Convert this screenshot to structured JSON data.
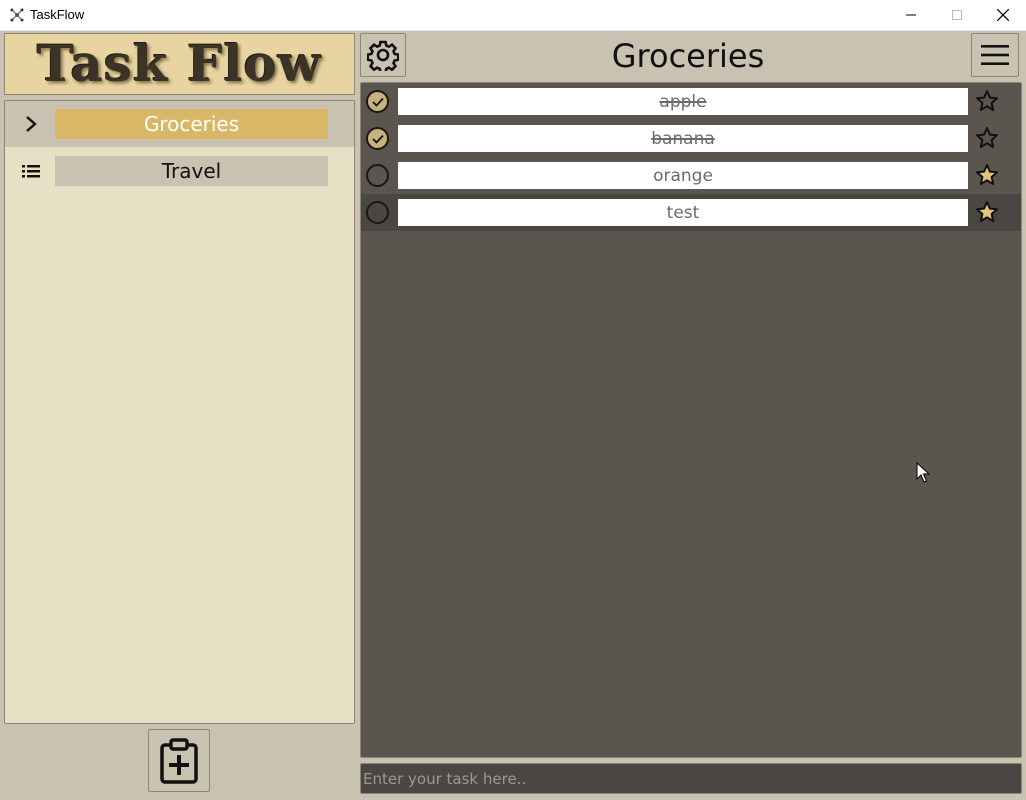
{
  "window": {
    "title": "TaskFlow",
    "controls": [
      "minimize",
      "maximize",
      "close"
    ]
  },
  "logo": {
    "text": "Task Flow"
  },
  "lists": [
    {
      "label": "Groceries",
      "icon": "chevron-right-icon",
      "selected": true
    },
    {
      "label": "Travel",
      "icon": "list-icon",
      "selected": false
    }
  ],
  "header": {
    "title": "Groceries"
  },
  "tasks": [
    {
      "text": "apple",
      "done": true,
      "starred": false
    },
    {
      "text": "banana",
      "done": true,
      "starred": false
    },
    {
      "text": "orange",
      "done": false,
      "starred": true
    },
    {
      "text": "test",
      "done": false,
      "starred": true
    }
  ],
  "input": {
    "placeholder": "Enter your task here.."
  },
  "colors": {
    "accent": "#d8b766",
    "panel_light": "#e6e0c5",
    "task_area": "#5a554e",
    "star_fill": "#e2c37f"
  }
}
